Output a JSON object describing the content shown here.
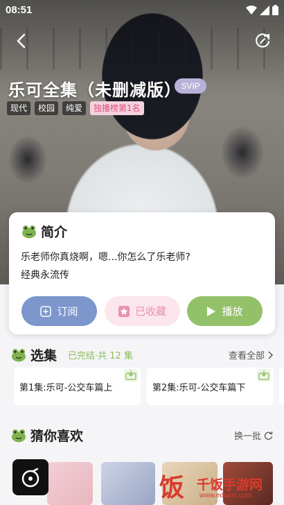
{
  "status_bar": {
    "time": "08:51"
  },
  "header": {
    "title": "乐可全集（未删减版）",
    "badge": "SVIP"
  },
  "tags": [
    "现代",
    "校园",
    "纯爱",
    "独播榜第1名"
  ],
  "intro": {
    "heading": "简介",
    "line1": "乐老师你真烧啊，嗯...你怎么了乐老师?",
    "line2": "经典永流传"
  },
  "actions": {
    "subscribe": "订阅",
    "favorited": "已收藏",
    "play": "播放"
  },
  "episodes": {
    "heading": "选集",
    "status": "已完结·共 12 集",
    "view_all": "查看全部",
    "items": [
      "第1集:乐可-公交车篇上",
      "第2集:乐可-公交车篇下"
    ]
  },
  "recommend": {
    "heading": "猜你喜欢",
    "refresh": "换一批"
  },
  "watermark": {
    "logo": "饭",
    "name": "千饭手游网",
    "url": "www.eduext.com"
  },
  "colors": {
    "subscribe": "#7d96cc",
    "favorited_bg": "#fbe6ec",
    "play": "#93c16a",
    "svip": "#b8b2d9",
    "accent_green": "#8bbd5c"
  }
}
